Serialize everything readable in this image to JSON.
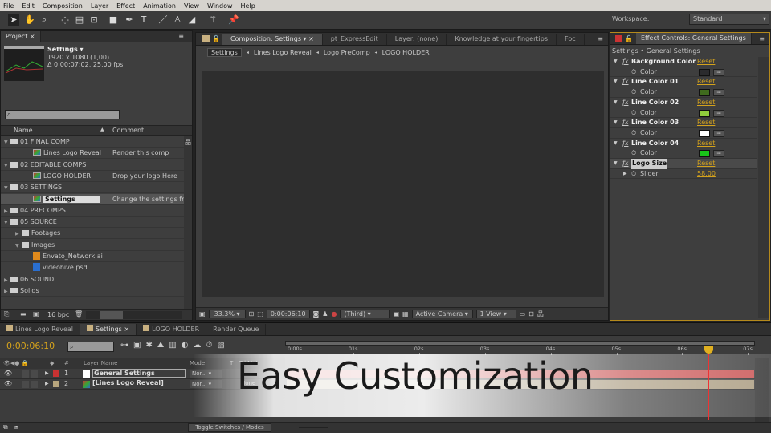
{
  "menu": [
    "File",
    "Edit",
    "Composition",
    "Layer",
    "Effect",
    "Animation",
    "View",
    "Window",
    "Help"
  ],
  "workspace": {
    "label": "Workspace:",
    "value": "Standard"
  },
  "project": {
    "tab": "Project",
    "selected": {
      "name": "Settings ▾",
      "resolution": "1920 x 1080 (1,00)",
      "duration": "Δ 0:00:07:02, 25,00 fps"
    },
    "columns": {
      "name": "Name",
      "comment": "Comment"
    },
    "items": [
      {
        "name": "01 FINAL COMP",
        "type": "folder",
        "expanded": true,
        "indent": 0,
        "comment": ""
      },
      {
        "name": "Lines Logo Reveal",
        "type": "comp",
        "indent": 2,
        "comment": "Render this comp"
      },
      {
        "name": "02 EDITABLE COMPS",
        "type": "folder",
        "expanded": true,
        "indent": 0,
        "comment": ""
      },
      {
        "name": "LOGO HOLDER",
        "type": "comp",
        "indent": 2,
        "comment": "Drop your logo Here"
      },
      {
        "name": "03 SETTINGS",
        "type": "folder",
        "expanded": true,
        "indent": 0,
        "comment": ""
      },
      {
        "name": "Settings",
        "type": "comp",
        "indent": 2,
        "comment": "Change the settings fro",
        "selected": true
      },
      {
        "name": "04 PRECOMPS",
        "type": "folder",
        "expanded": false,
        "indent": 0,
        "comment": ""
      },
      {
        "name": "05 SOURCE",
        "type": "folder",
        "expanded": true,
        "indent": 0,
        "comment": ""
      },
      {
        "name": "Footages",
        "type": "folder",
        "expanded": false,
        "indent": 1,
        "comment": ""
      },
      {
        "name": "Images",
        "type": "folder",
        "expanded": true,
        "indent": 1,
        "comment": ""
      },
      {
        "name": "Envato_Network.ai",
        "type": "ai",
        "indent": 2,
        "comment": ""
      },
      {
        "name": "videohive.psd",
        "type": "psd",
        "indent": 2,
        "comment": ""
      },
      {
        "name": "06 SOUND",
        "type": "folder",
        "expanded": false,
        "indent": 0,
        "comment": ""
      },
      {
        "name": "Solids",
        "type": "folder",
        "expanded": false,
        "indent": 0,
        "comment": ""
      }
    ],
    "bpc": "16 bpc"
  },
  "composition": {
    "tabs": [
      "Composition: Settings",
      "pt_ExpressEdit",
      "Layer: (none)",
      "Knowledge at your fingertips",
      "Foc"
    ],
    "breadcrumb": [
      "Settings",
      "Lines Logo Reveal",
      "Logo PreComp",
      "LOGO HOLDER"
    ],
    "zoom": "33.3%",
    "timecode": "0:00:06:10",
    "resolution": "(Third)",
    "camera": "Active Camera",
    "views": "1 View"
  },
  "effects": {
    "tab": "Effect Controls: General Settings",
    "path": "Settings • General Settings",
    "items": [
      {
        "name": "Background Color",
        "prop": "Color",
        "color": "#2b2b2d"
      },
      {
        "name": "Line Color 01",
        "prop": "Color",
        "color": "#3f6a1e"
      },
      {
        "name": "Line Color 02",
        "prop": "Color",
        "color": "#8fcc3c"
      },
      {
        "name": "Line Color 03",
        "prop": "Color",
        "color": "#ffffff"
      },
      {
        "name": "Line Color 04",
        "prop": "Color",
        "color": "#19c419"
      },
      {
        "name": "Logo Size",
        "prop": "Slider",
        "value": "58,00"
      }
    ],
    "reset": "Reset",
    "fx": "fx"
  },
  "timeline": {
    "tabs": [
      "Lines Logo Reveal",
      "Settings",
      "LOGO HOLDER",
      "Render Queue"
    ],
    "timecode": "0:00:06:10",
    "columns": {
      "num": "#",
      "name": "Layer Name",
      "mode": "Mode",
      "t": "T",
      "trkmat": "TrkMat"
    },
    "layers": [
      {
        "num": "1",
        "name": "General Settings",
        "mode": "Nor...",
        "label": "#c83232",
        "bar": "#c85050"
      },
      {
        "num": "2",
        "name": "[Lines Logo Reveal]",
        "mode": "Nor...",
        "label": "#b8a67e",
        "bar": "#a99a7e",
        "trkmat": "None"
      }
    ],
    "ruler": [
      "0:00s",
      "01s",
      "02s",
      "03s",
      "04s",
      "05s",
      "06s",
      "07s"
    ],
    "playhead_seconds": 6.4,
    "toggle": "Toggle Switches / Modes"
  },
  "overlay": {
    "caption": "Easy Customization"
  }
}
